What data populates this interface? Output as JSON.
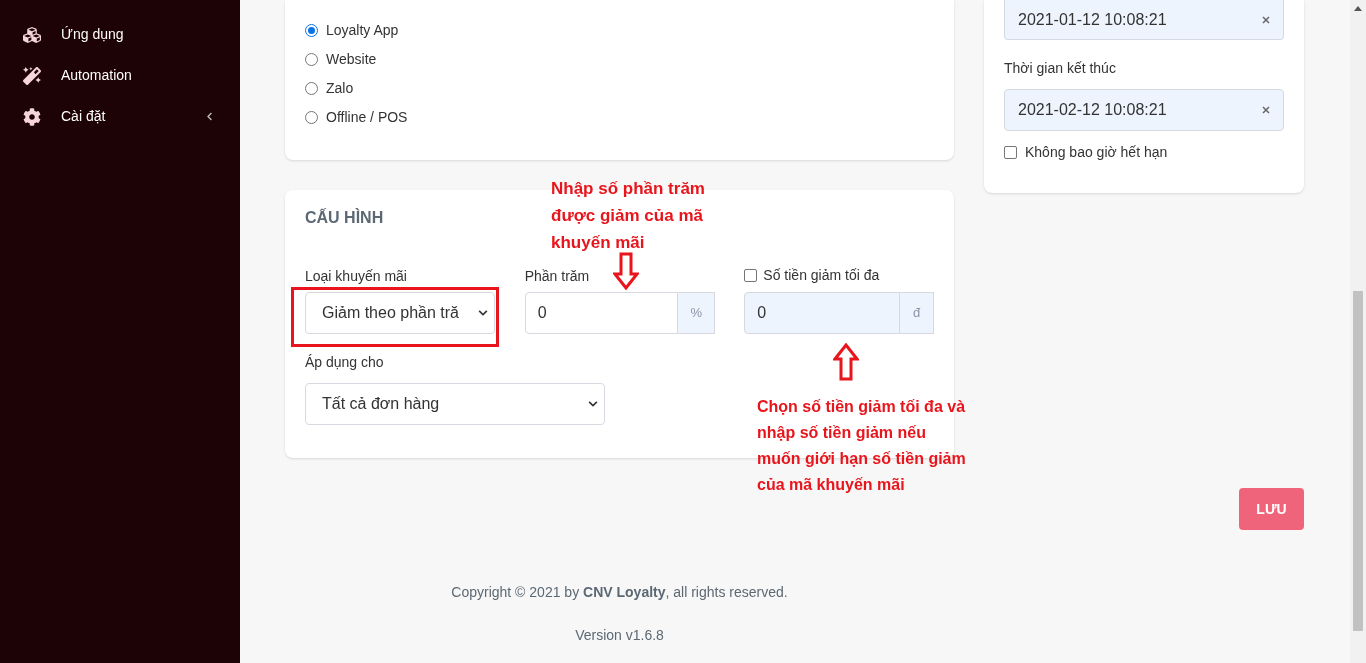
{
  "sidebar": {
    "items": [
      {
        "label": "Ứng dụng",
        "has_submenu": false
      },
      {
        "label": "Automation",
        "has_submenu": false
      },
      {
        "label": "Cài đặt",
        "has_submenu": true
      }
    ]
  },
  "channels": [
    {
      "label": "Loyalty App",
      "selected": true
    },
    {
      "label": "Website",
      "selected": false
    },
    {
      "label": "Zalo",
      "selected": false
    },
    {
      "label": "Offline / POS",
      "selected": false
    }
  ],
  "config": {
    "title": "CẤU HÌNH",
    "promo_type": {
      "label": "Loại khuyến mãi",
      "value": "Giảm theo phần tră"
    },
    "percent": {
      "label": "Phần trăm",
      "value": "0",
      "suffix": "%"
    },
    "max_discount": {
      "label": "Số tiền giảm tối đa",
      "checked": false,
      "value": "0",
      "suffix": "đ",
      "disabled": true
    },
    "apply_for": {
      "label": "Áp dụng cho",
      "value": "Tất cả đơn hàng"
    }
  },
  "time": {
    "start_value": "2021-01-12 10:08:21",
    "end_label": "Thời gian kết thúc",
    "end_value": "2021-02-12 10:08:21",
    "never_expire": {
      "label": "Không bao giờ hết hạn",
      "checked": false
    }
  },
  "save_button": "LƯU",
  "footer": {
    "copyright": "Copyright © 2021 by **CNV Loyalty**, all rights reserved.",
    "version": "Version v1.6.8"
  },
  "annotations": [
    {
      "text": "Nhập số phần trăm được giảm của mã khuyến mãi"
    },
    {
      "text": "Chọn số tiền giảm tối đa và nhập số tiền giảm nếu muốn giới hạn số tiền giảm của mã khuyến mãi"
    }
  ]
}
